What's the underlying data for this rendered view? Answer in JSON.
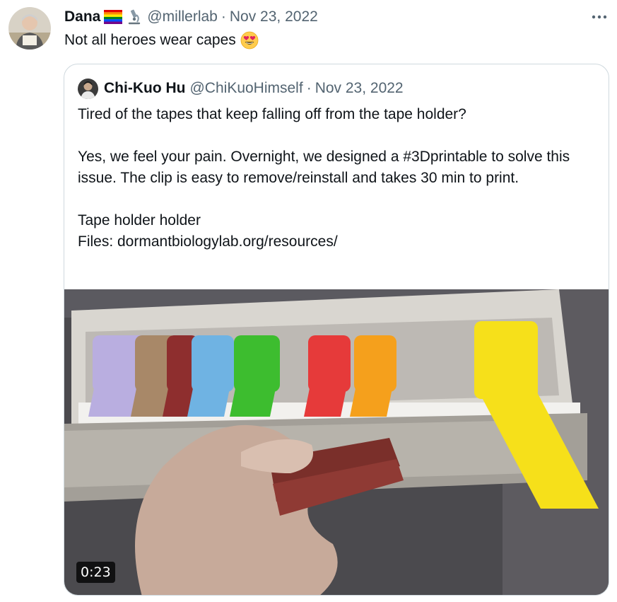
{
  "tweet": {
    "author_name": "Dana",
    "author_handle": "@millerlab",
    "separator": "·",
    "date": "Nov 23, 2022",
    "text": "Not all heroes wear capes",
    "badges": [
      "rainbow-flag-icon",
      "microscope-icon"
    ],
    "emoji": "heart-eyes-emoji-icon",
    "more_icon": "more-icon"
  },
  "quoted": {
    "author_name": "Chi-Kuo Hu",
    "author_handle": "@ChiKuoHimself",
    "separator": "·",
    "date": "Nov 23, 2022",
    "paragraphs": [
      "Tired of the tapes that keep falling off from the tape holder?",
      "Yes, we feel your pain.  Overnight, we designed a #3Dprintable to solve this issue.  The clip is easy to remove/reinstall and takes 30 min to print.",
      "Tape holder holder",
      "Files: dormantbiologylab.org/resources/"
    ],
    "video": {
      "duration": "0:23",
      "tape_colors": [
        "#b9aee0",
        "#a88868",
        "#8e2e2e",
        "#6fb3e3",
        "#3dbd2f",
        "#e63a3a",
        "#f5a01c",
        "#f6e01a"
      ]
    }
  },
  "colors": {
    "text_primary": "#0f1419",
    "text_secondary": "#536471",
    "border": "#cfd9de"
  }
}
